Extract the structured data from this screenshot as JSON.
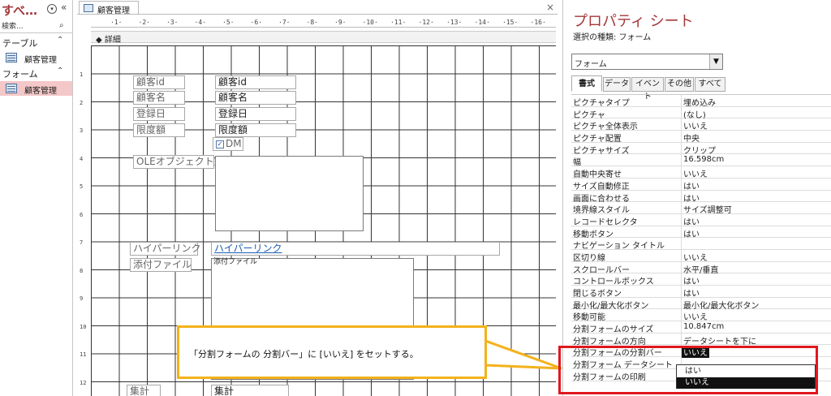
{
  "nav": {
    "title": "すべ…",
    "search_placeholder": "検索...",
    "groups": [
      {
        "label": "テーブル",
        "items": [
          "顧客管理"
        ]
      },
      {
        "label": "フォーム",
        "items": [
          "顧客管理"
        ]
      }
    ]
  },
  "design": {
    "tab_label": "顧客管理",
    "ruler_marks": "·1·,·2·,·3·,·4·,·5·,·6·,·7·,·8·,·9·,·10·,·11·,·12·,·13·,·14·,·15·,·16·",
    "vruler": [
      "1",
      "2",
      "3",
      "4",
      "5",
      "6",
      "7",
      "8",
      "9",
      "10",
      "11",
      "12"
    ],
    "section_label": "◆ 詳細",
    "controls": {
      "label_id": "顧客id",
      "box_id": "顧客id",
      "label_name": "顧客名",
      "box_name": "顧客名",
      "label_date": "登録日",
      "box_date": "登録日",
      "label_limit": "限度額",
      "box_limit": "限度額",
      "chk_label": "DM",
      "label_ole": "OLEオブジェクト型",
      "label_link": "ハイパーリンク",
      "box_link": "ハイパーリンク",
      "label_attach": "添付ファイル",
      "box_attach": "添付ファイル",
      "label_total": "集計",
      "box_total": "集計"
    },
    "callout": "「分割フォームの 分割バー」に [いいえ] をセットする。"
  },
  "props": {
    "title": "プロパティ シート",
    "subtitle": "選択の種類: フォーム",
    "selector_value": "フォーム",
    "tabs": [
      "書式",
      "データ",
      "イベント",
      "その他",
      "すべて"
    ],
    "rows": [
      {
        "k": "ピクチャタイプ",
        "v": "埋め込み"
      },
      {
        "k": "ピクチャ",
        "v": "(なし)"
      },
      {
        "k": "ピクチャ全体表示",
        "v": "いいえ"
      },
      {
        "k": "ピクチャ配置",
        "v": "中央"
      },
      {
        "k": "ピクチャサイズ",
        "v": "クリップ"
      },
      {
        "k": "幅",
        "v": "16.598cm"
      },
      {
        "k": "自動中央寄せ",
        "v": "いいえ"
      },
      {
        "k": "サイズ自動修正",
        "v": "はい"
      },
      {
        "k": "画面に合わせる",
        "v": "はい"
      },
      {
        "k": "境界線スタイル",
        "v": "サイズ調整可"
      },
      {
        "k": "レコードセレクタ",
        "v": "はい"
      },
      {
        "k": "移動ボタン",
        "v": "はい"
      },
      {
        "k": "ナビゲーション タイトル",
        "v": ""
      },
      {
        "k": "区切り線",
        "v": "いいえ"
      },
      {
        "k": "スクロールバー",
        "v": "水平/垂直"
      },
      {
        "k": "コントロールボックス",
        "v": "はい"
      },
      {
        "k": "閉じるボタン",
        "v": "はい"
      },
      {
        "k": "最小化/最大化ボタン",
        "v": "最小化/最大化ボタン"
      },
      {
        "k": "移動可能",
        "v": "いいえ"
      },
      {
        "k": "分割フォームのサイズ",
        "v": "10.847cm"
      },
      {
        "k": "分割フォームの方向",
        "v": "データシートを下に"
      },
      {
        "k": "分割フォームの分割バー",
        "v": "いいえ"
      },
      {
        "k": "分割フォーム データシート",
        "v": ""
      },
      {
        "k": "分割フォームの印刷",
        "v": ""
      }
    ],
    "dropdown_options": [
      "はい",
      "いいえ"
    ]
  }
}
